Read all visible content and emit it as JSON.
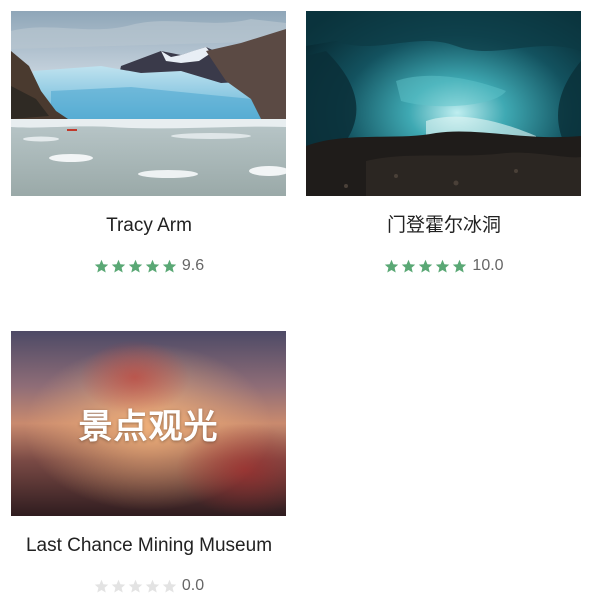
{
  "colors": {
    "star_filled": "#5aa875",
    "star_empty": "#e3e3e3",
    "title_text": "#222222",
    "score_text": "#666666"
  },
  "cards": [
    {
      "title": "Tracy Arm",
      "rating": 9.6,
      "rating_label": "9.6",
      "stars_filled": 5,
      "image": "glacier-fjord-photo"
    },
    {
      "title": "门登霍尔冰洞",
      "rating": 10.0,
      "rating_label": "10.0",
      "stars_filled": 5,
      "image": "ice-cave-photo"
    },
    {
      "title": "Last Chance Mining Museum",
      "rating": 0.0,
      "rating_label": "0.0",
      "stars_filled": 0,
      "image": "blurred-placeholder",
      "image_overlay_text": "景点观光"
    }
  ]
}
